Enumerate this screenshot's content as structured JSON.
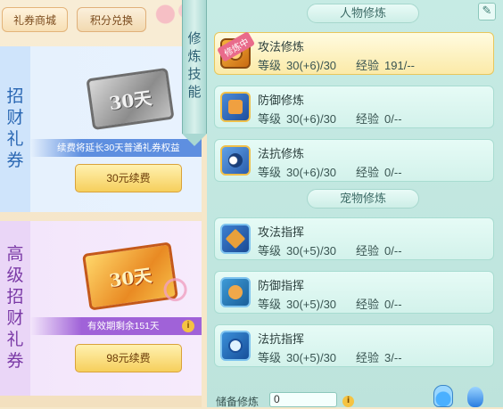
{
  "shop": {
    "tabs": [
      "礼券商城",
      "积分兑换"
    ],
    "basic": {
      "side_label": "招财礼券",
      "ticket_text": "30天",
      "info": "续费将延长30天普通礼券权益",
      "button": "30元续费"
    },
    "premium": {
      "side_label": "高级招财礼券",
      "ticket_text": "30天",
      "info": "有效期剩余151天",
      "button": "98元续费"
    }
  },
  "ribbon_label": "修炼技能",
  "cultivation": {
    "person_title": "人物修炼",
    "pet_title": "宠物修炼",
    "training_badge": "修炼中",
    "level_label": "等级",
    "exp_label": "经验",
    "person_skills": [
      {
        "name": "攻法修炼",
        "level": "30(+6)/30",
        "exp": "191/--",
        "icon": "attack-icon",
        "active": true
      },
      {
        "name": "防御修炼",
        "level": "30(+6)/30",
        "exp": "0/--",
        "icon": "defense-icon",
        "active": false
      },
      {
        "name": "法抗修炼",
        "level": "30(+6)/30",
        "exp": "0/--",
        "icon": "resist-icon",
        "active": false
      }
    ],
    "pet_skills": [
      {
        "name": "攻法指挥",
        "level": "30(+5)/30",
        "exp": "0/--",
        "icon": "command-attack-icon"
      },
      {
        "name": "防御指挥",
        "level": "30(+5)/30",
        "exp": "0/--",
        "icon": "command-defense-icon"
      },
      {
        "name": "法抗指挥",
        "level": "30(+5)/30",
        "exp": "3/--",
        "icon": "command-resist-icon"
      }
    ],
    "reserve_label": "储备修炼",
    "reserve_value": "0"
  },
  "colors": {
    "panel_bg": "#c6ebe4",
    "active_row": "#fbeaa8",
    "basic_accent": "#5e8fe0",
    "premium_accent": "#a062d8",
    "button_gold": "#f6cf5c"
  }
}
